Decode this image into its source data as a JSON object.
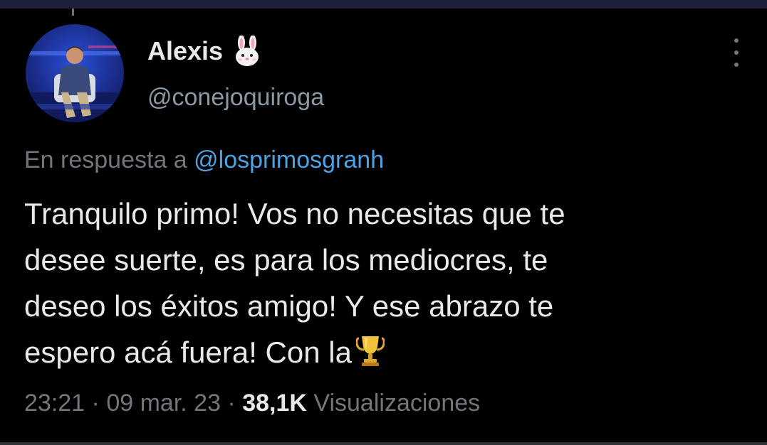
{
  "tweet": {
    "author": {
      "display_name": "Alexis",
      "name_emoji": "🐰",
      "handle": "@conejoquiroga",
      "avatar_icon": "avatar-photo"
    },
    "reply_prefix": "En respuesta a",
    "reply_to": "@losprimosgranh",
    "text_lines": [
      "Tranquilo primo! Vos no necesitas que te",
      "desee suerte, es para los mediocres, te",
      "deseo los éxitos amigo! Y ese abrazo te",
      "espero acá fuera! Con la"
    ],
    "text_emoji": "🏆",
    "time": "23:21",
    "separator": "·",
    "date": "09 mar. 23",
    "views_count": "38,1K",
    "views_label": "Visualizaciones",
    "more_icon": "more-vertical-icon"
  },
  "colors": {
    "background": "#000000",
    "text_primary": "#e7e9ea",
    "text_secondary": "#71767b",
    "link": "#4ba3e4",
    "top_bar": "#1c2038"
  }
}
